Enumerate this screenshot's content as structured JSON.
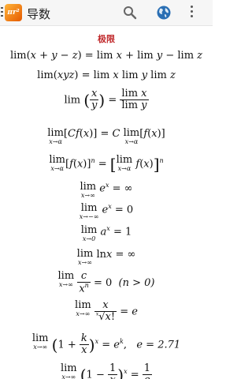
{
  "app": {
    "logo_text": "πr²",
    "title": "导数"
  },
  "section": {
    "title": "极限"
  },
  "texts": {
    "cond_n": "(n > 0)",
    "e_value": "e = 2.71"
  },
  "icons": [
    "menu-icon",
    "app-logo-icon",
    "search-icon",
    "globe-icon",
    "overflow-menu-icon"
  ],
  "colors": {
    "appbar_bg": "#f6f6f6",
    "section_title": "#c0282a",
    "globe": "#2a6fb4"
  }
}
